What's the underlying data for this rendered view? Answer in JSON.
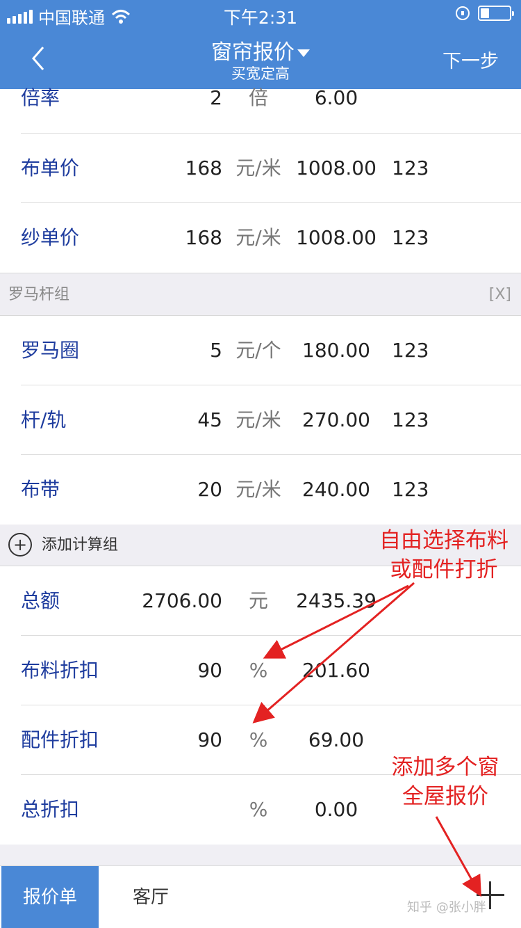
{
  "status": {
    "carrier": "中国联通",
    "time": "下午2:31"
  },
  "nav": {
    "title": "窗帘报价",
    "subtitle": "买宽定高",
    "next": "下一步"
  },
  "rows_top": [
    {
      "label": "倍率",
      "value": "2",
      "unit": "倍",
      "amount": "6.00",
      "extra": ""
    },
    {
      "label": "布单价",
      "value": "168",
      "unit": "元/米",
      "amount": "1008.00",
      "extra": "123"
    },
    {
      "label": "纱单价",
      "value": "168",
      "unit": "元/米",
      "amount": "1008.00",
      "extra": "123"
    }
  ],
  "group": {
    "title": "罗马杆组",
    "remove": "[X]",
    "rows": [
      {
        "label": "罗马圈",
        "value": "5",
        "unit": "元/个",
        "amount": "180.00",
        "extra": "123"
      },
      {
        "label": "杆/轨",
        "value": "45",
        "unit": "元/米",
        "amount": "270.00",
        "extra": "123"
      },
      {
        "label": "布带",
        "value": "20",
        "unit": "元/米",
        "amount": "240.00",
        "extra": "123"
      }
    ]
  },
  "add_group": {
    "label": "添加计算组",
    "plus": "+"
  },
  "totals": [
    {
      "label": "总额",
      "value": "2706.00",
      "unit": "元",
      "amount": "2435.39"
    },
    {
      "label": "布料折扣",
      "value": "90",
      "unit": "%",
      "amount": "201.60"
    },
    {
      "label": "配件折扣",
      "value": "90",
      "unit": "%",
      "amount": "69.00"
    },
    {
      "label": "总折扣",
      "value": "",
      "unit": "%",
      "amount": "0.00"
    }
  ],
  "tabs": {
    "active": "报价单",
    "second": "客厅"
  },
  "watermark": "知乎 @张小胖",
  "annotations": {
    "a1_line1": "自由选择布料",
    "a1_line2": "或配件打折",
    "a2_line1": "添加多个窗",
    "a2_line2": "全屋报价"
  },
  "colors": {
    "primary": "#4a88d6",
    "label": "#1e3c9e",
    "annotation": "#e32222"
  }
}
